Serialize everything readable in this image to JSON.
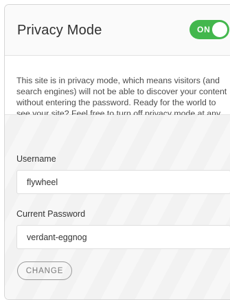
{
  "header": {
    "title": "Privacy Mode",
    "toggle": {
      "label": "ON",
      "state": "on",
      "color": "#43b74d"
    }
  },
  "description": "This site is in privacy mode, which means visitors (and search engines) will not be able to discover your content without entering the password. Ready for the world to see your site? Feel free to turn off privacy mode at any time.",
  "form": {
    "username": {
      "label": "Username",
      "value": "flywheel"
    },
    "password": {
      "label": "Current Password",
      "value": "verdant-eggnog"
    },
    "change_label": "CHANGE"
  }
}
